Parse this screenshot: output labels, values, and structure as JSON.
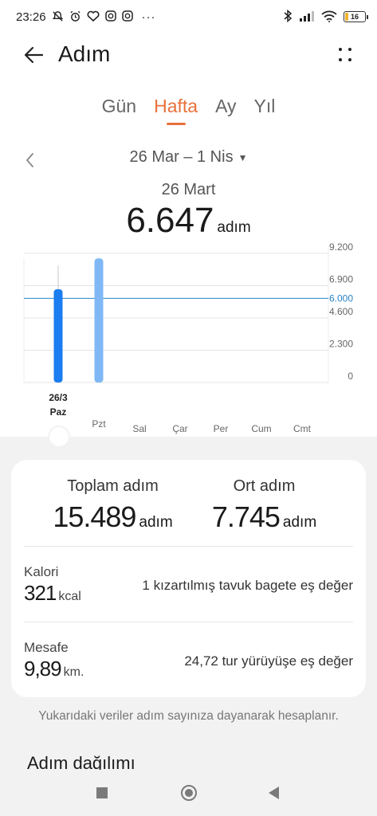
{
  "status_bar": {
    "time": "23:26",
    "more": "···",
    "battery": "16",
    "battery_level_percent": 16
  },
  "header": {
    "title": "Adım"
  },
  "tabs": [
    {
      "label": "Gün",
      "active": false
    },
    {
      "label": "Hafta",
      "active": true
    },
    {
      "label": "Ay",
      "active": false
    },
    {
      "label": "Yıl",
      "active": false
    }
  ],
  "date_selector": {
    "range": "26 Mar – 1 Nis"
  },
  "selected": {
    "date": "26 Mart",
    "steps": "6.647",
    "unit": "adım"
  },
  "chart_data": {
    "type": "bar",
    "categories": [
      "26/3 Paz",
      "Pzt",
      "Sal",
      "Çar",
      "Per",
      "Cum",
      "Cmt"
    ],
    "category_labels": [
      {
        "top": "26/3",
        "bottom": "Paz"
      },
      {
        "top": "Pzt",
        "bottom": ""
      },
      {
        "top": "Sal",
        "bottom": ""
      },
      {
        "top": "Çar",
        "bottom": ""
      },
      {
        "top": "Per",
        "bottom": ""
      },
      {
        "top": "Cum",
        "bottom": ""
      },
      {
        "top": "Cmt",
        "bottom": ""
      }
    ],
    "values": [
      6647,
      8842,
      0,
      0,
      0,
      0,
      0
    ],
    "selected_index": 0,
    "y_ticks": [
      "9.200",
      "6.900",
      "4.600",
      "2.300",
      "0"
    ],
    "y_tick_values": [
      9200,
      6900,
      4600,
      2300,
      0
    ],
    "ylim": [
      0,
      9200
    ],
    "goal": {
      "value": 6000,
      "label": "6.000"
    },
    "colors": {
      "selected": "#1a7df0",
      "bar": "#7fb8f5",
      "goal": "#2a86c9"
    },
    "grid": true
  },
  "summary": {
    "total": {
      "label": "Toplam adım",
      "value": "15.489",
      "unit": "adım"
    },
    "average": {
      "label": "Ort adım",
      "value": "7.745",
      "unit": "adım"
    }
  },
  "calories": {
    "label": "Kalori",
    "value": "321",
    "unit": "kcal",
    "equivalent": "1 kızartılmış tavuk bagete eş değer"
  },
  "distance": {
    "label": "Mesafe",
    "value": "9,89",
    "unit": "km.",
    "equivalent": "24,72 tur yürüyüşe eş değer"
  },
  "footnote": "Yukarıdaki veriler adım sayınıza dayanarak hesaplanır.",
  "section_title": "Adım dağılımı"
}
